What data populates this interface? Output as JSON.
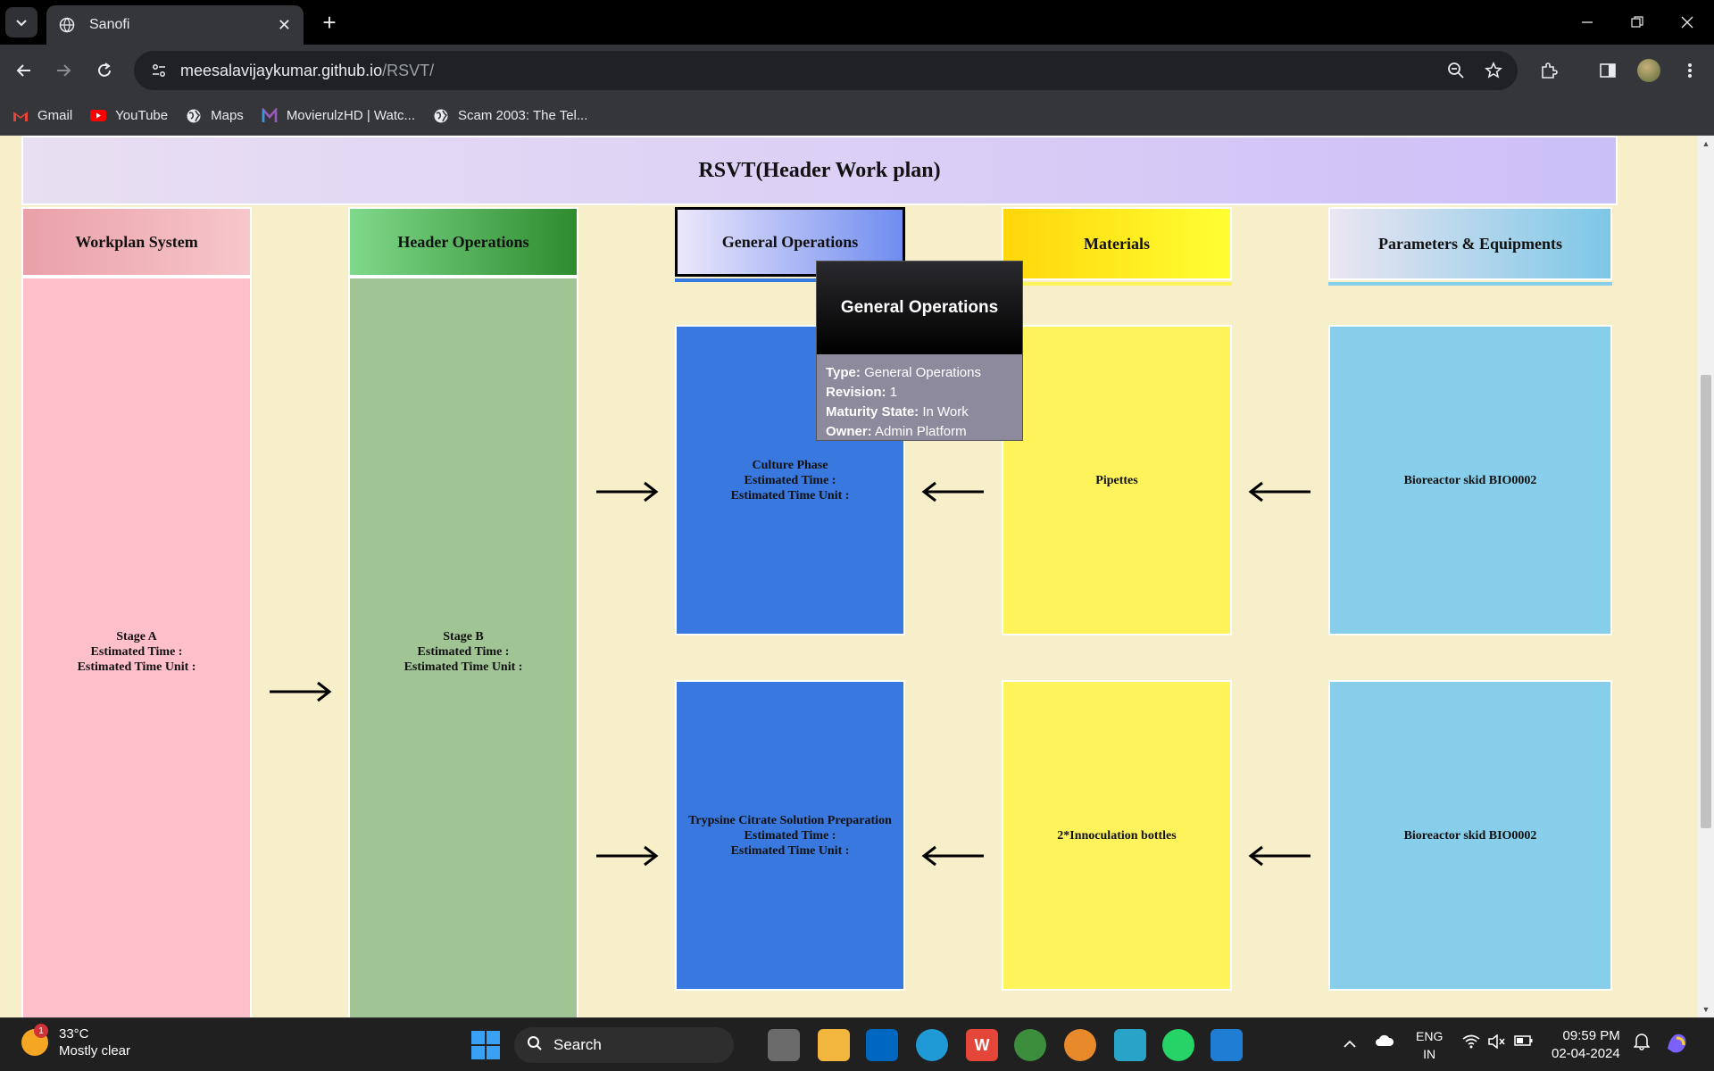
{
  "browser": {
    "tab_title": "Sanofi",
    "tab_close": "✕",
    "new_tab": "+",
    "url_host": "meesalavijaykumar.github.io",
    "url_path": "/RSVT/",
    "bookmarks": [
      {
        "label": "Gmail",
        "icon": "gmail-icon",
        "color": "#ea4335"
      },
      {
        "label": "YouTube",
        "icon": "youtube-icon",
        "color": "#ff0000"
      },
      {
        "label": "Maps",
        "icon": "globe-icon",
        "color": "#e8eaed"
      },
      {
        "label": "MovierulzHD | Watc...",
        "icon": "m-icon",
        "color": "#9b59b6"
      },
      {
        "label": "Scam 2003: The Tel...",
        "icon": "globe-icon",
        "color": "#e8eaed"
      }
    ]
  },
  "page": {
    "title": "RSVT(Header Work plan)",
    "columns": {
      "workplan": "Workplan System",
      "header_ops": "Header Operations",
      "general_ops": "General Operations",
      "materials": "Materials",
      "params": "Parameters & Equipments"
    },
    "stage_a": {
      "name": "Stage A",
      "time": "Estimated Time :",
      "unit": "Estimated Time Unit :"
    },
    "stage_b": {
      "name": "Stage B",
      "time": "Estimated Time :",
      "unit": "Estimated Time Unit :"
    },
    "general_1": {
      "name": "Culture Phase",
      "time": "Estimated Time :",
      "unit": "Estimated Time Unit :"
    },
    "general_2": {
      "name": "Trypsine Citrate Solution Preparation",
      "time": "Estimated Time :",
      "unit": "Estimated Time Unit :"
    },
    "material_1": "Pipettes",
    "material_2": "2*Innoculation bottles",
    "param_1": "Bioreactor skid BIO0002",
    "param_2": "Bioreactor skid BIO0002"
  },
  "tooltip": {
    "title": "General Operations",
    "type_label": "Type:",
    "type_value": "General Operations",
    "revision_label": "Revision:",
    "revision_value": "1",
    "maturity_label": "Maturity State:",
    "maturity_value": "In Work",
    "owner_label": "Owner:",
    "owner_value": "Admin Platform"
  },
  "taskbar": {
    "temp": "33°C",
    "weather": "Mostly clear",
    "weather_badge": "1",
    "search": "Search",
    "lang_1": "ENG",
    "lang_2": "IN",
    "time": "09:59 PM",
    "date": "02-04-2024"
  },
  "colors": {
    "page_bg": "#f7efca",
    "general_box": "#3878df",
    "material_box": "#fff35c",
    "param_box": "#87ceeb",
    "stage_a_box": "#ffc0cb",
    "stage_b_box": "#a1c495"
  }
}
